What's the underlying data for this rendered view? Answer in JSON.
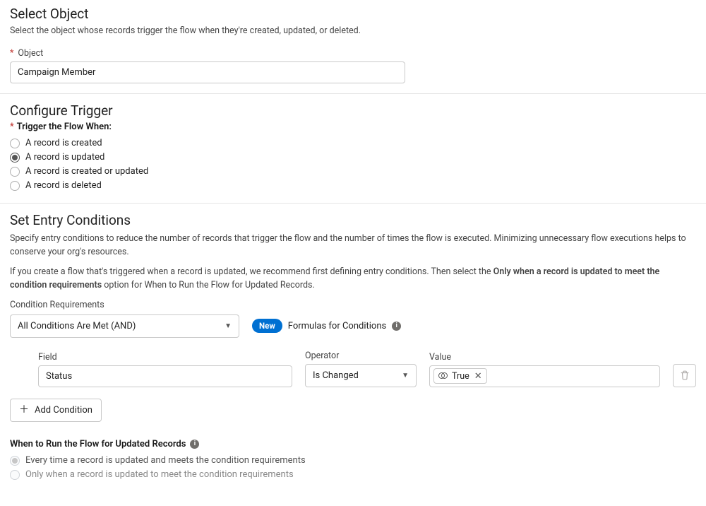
{
  "selectObject": {
    "title": "Select Object",
    "desc": "Select the object whose records trigger the flow when they're created, updated, or deleted.",
    "fieldLabel": "Object",
    "value": "Campaign Member"
  },
  "configureTrigger": {
    "title": "Configure Trigger",
    "groupLabel": "Trigger the Flow When:",
    "options": [
      {
        "label": "A record is created",
        "selected": false
      },
      {
        "label": "A record is updated",
        "selected": true
      },
      {
        "label": "A record is created or updated",
        "selected": false
      },
      {
        "label": "A record is deleted",
        "selected": false
      }
    ]
  },
  "entryConditions": {
    "title": "Set Entry Conditions",
    "desc1": "Specify entry conditions to reduce the number of records that trigger the flow and the number of times the flow is executed. Minimizing unnecessary flow executions helps to conserve your org's resources.",
    "desc2a": "If you create a flow that's triggered when a record is updated, we recommend first defining entry conditions. Then select the ",
    "desc2b": "Only when a record is updated to meet the condition requirements",
    "desc2c": " option for When to Run the Flow for Updated Records.",
    "condReqLabel": "Condition Requirements",
    "condReqValue": "All Conditions Are Met (AND)",
    "newPill": "New",
    "formulasText": "Formulas for Conditions",
    "condition": {
      "fieldLabel": "Field",
      "fieldValue": "Status",
      "operatorLabel": "Operator",
      "operatorValue": "Is Changed",
      "valueLabel": "Value",
      "valueToken": "True"
    },
    "addConditionLabel": "Add Condition"
  },
  "whenToRun": {
    "title": "When to Run the Flow for Updated Records",
    "options": [
      {
        "label": "Every time a record is updated and meets the condition requirements",
        "selected": true
      },
      {
        "label": "Only when a record is updated to meet the condition requirements",
        "selected": false
      }
    ]
  }
}
